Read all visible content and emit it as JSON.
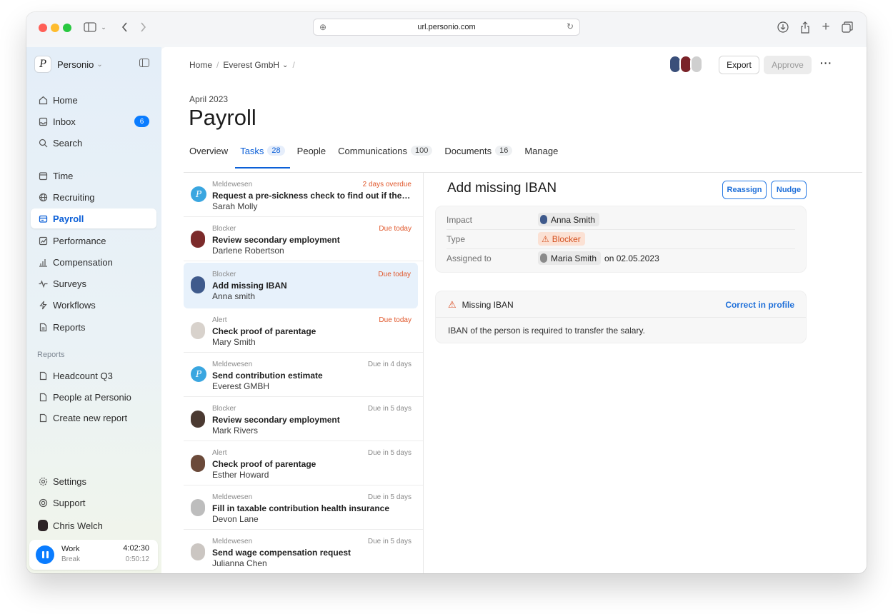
{
  "browser": {
    "url": "url.personio.com"
  },
  "sidebar": {
    "brand": "Personio",
    "nav": [
      {
        "label": "Home",
        "icon": "home-icon"
      },
      {
        "label": "Inbox",
        "icon": "inbox-icon",
        "badge": "6"
      },
      {
        "label": "Search",
        "icon": "search-icon"
      },
      {
        "label": "Time",
        "icon": "calendar-icon"
      },
      {
        "label": "Recruiting",
        "icon": "globe-icon"
      },
      {
        "label": "Payroll",
        "icon": "payroll-icon",
        "active": true
      },
      {
        "label": "Performance",
        "icon": "chart-line-icon"
      },
      {
        "label": "Compensation",
        "icon": "bar-chart-icon"
      },
      {
        "label": "Surveys",
        "icon": "pulse-icon"
      },
      {
        "label": "Workflows",
        "icon": "bolt-icon"
      },
      {
        "label": "Reports",
        "icon": "report-icon"
      }
    ],
    "reports_section_label": "Reports",
    "reports": [
      {
        "label": "Headcount Q3"
      },
      {
        "label": "People at Personio"
      },
      {
        "label": "Create new report"
      }
    ],
    "settings_label": "Settings",
    "support_label": "Support",
    "user_name": "Chris Welch",
    "timer": {
      "work_label": "Work",
      "work_time": "4:02:30",
      "break_label": "Break",
      "break_time": "0:50:12"
    }
  },
  "header": {
    "breadcrumb_home": "Home",
    "breadcrumb_company": "Everest GmbH",
    "export_label": "Export",
    "approve_label": "Approve",
    "more_label": "···"
  },
  "page": {
    "period": "April 2023",
    "title": "Payroll",
    "tabs": [
      {
        "label": "Overview"
      },
      {
        "label": "Tasks",
        "count": "28",
        "active": true
      },
      {
        "label": "People"
      },
      {
        "label": "Communications",
        "count": "100"
      },
      {
        "label": "Documents",
        "count": "16"
      },
      {
        "label": "Manage"
      }
    ]
  },
  "tasks": [
    {
      "type": "Meldewesen",
      "due": "2 days overdue",
      "title": "Request a pre-sickness check to find out if the si...",
      "person": "Sarah Molly"
    },
    {
      "type": "Blocker",
      "due": "Due today",
      "title": "Review secondary employment",
      "person": "Darlene Robertson"
    },
    {
      "type": "Blocker",
      "due": "Due today",
      "title": "Add missing IBAN",
      "person": "Anna smith"
    },
    {
      "type": "Alert",
      "due": "Due today",
      "title": "Check proof of parentage",
      "person": "Mary Smith"
    },
    {
      "type": "Meldewesen",
      "due": "Due in 4 days",
      "title": "Send contribution estimate",
      "person": "Everest GMBH"
    },
    {
      "type": "Blocker",
      "due": "Due in 5 days",
      "title": "Review secondary employment",
      "person": "Mark Rivers"
    },
    {
      "type": "Alert",
      "due": "Due in 5 days",
      "title": "Check proof of parentage",
      "person": "Esther Howard"
    },
    {
      "type": "Meldewesen",
      "due": "Due in 5 days",
      "title": "Fill in taxable contribution health insurance",
      "person": "Devon Lane"
    },
    {
      "type": "Meldewesen",
      "due": "Due in 5 days",
      "title": "Send wage compensation request",
      "person": "Julianna Chen"
    }
  ],
  "detail": {
    "title": "Add missing IBAN",
    "reassign_label": "Reassign",
    "nudge_label": "Nudge",
    "impact_label": "Impact",
    "impact_value": "Anna Smith",
    "type_label": "Type",
    "type_value": "Blocker",
    "assigned_label": "Assigned to",
    "assigned_value": "Maria Smith",
    "assigned_date": "on 02.05.2023",
    "alert_title": "Missing IBAN",
    "alert_link": "Correct in profile",
    "alert_body": "IBAN of the person is required to transfer the salary."
  },
  "colors": {
    "accent": "#0b5fd7",
    "badge": "#0a7cff",
    "warning": "#e0572b"
  }
}
